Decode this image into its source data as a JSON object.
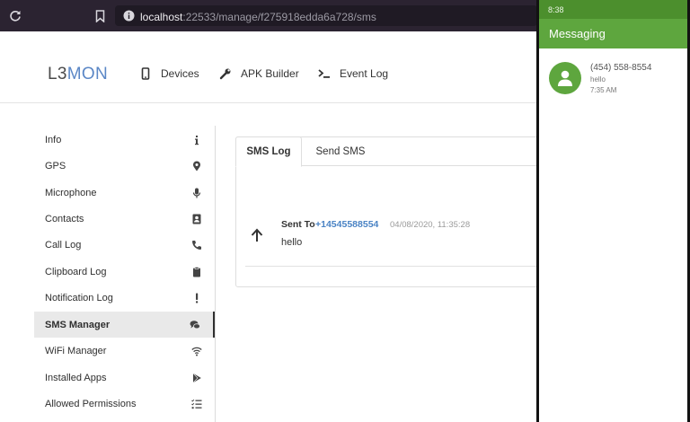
{
  "browser": {
    "url_host": "localhost",
    "url_rest": ":22533/manage/f275918edda6a728/sms"
  },
  "header": {
    "logo_part1": "L3",
    "logo_part2": "MON",
    "nav": [
      {
        "label": "Devices",
        "icon": "mobile-icon"
      },
      {
        "label": "APK Builder",
        "icon": "wrench-icon"
      },
      {
        "label": "Event Log",
        "icon": "terminal-icon"
      }
    ]
  },
  "sidebar": {
    "items": [
      {
        "label": "Info",
        "icon": "info-icon"
      },
      {
        "label": "GPS",
        "icon": "map-marker-icon"
      },
      {
        "label": "Microphone",
        "icon": "microphone-icon"
      },
      {
        "label": "Contacts",
        "icon": "address-book-icon"
      },
      {
        "label": "Call Log",
        "icon": "phone-icon"
      },
      {
        "label": "Clipboard Log",
        "icon": "clipboard-icon"
      },
      {
        "label": "Notification Log",
        "icon": "exclamation-icon"
      },
      {
        "label": "SMS Manager",
        "icon": "chat-icon",
        "active": true
      },
      {
        "label": "WiFi Manager",
        "icon": "wifi-icon"
      },
      {
        "label": "Installed Apps",
        "icon": "play-store-icon"
      },
      {
        "label": "Allowed Permissions",
        "icon": "list-icon"
      }
    ]
  },
  "tabs": {
    "sms_log": "SMS Log",
    "send_sms": "Send SMS"
  },
  "message": {
    "direction_label": "Sent To",
    "number": "+14545588554",
    "date": "04/08/2020, 11:35:28",
    "body": "hello"
  },
  "phone": {
    "status_time": "8:38",
    "app_title": "Messaging",
    "conversation": {
      "number": "(454) 558-8554",
      "snippet": "hello",
      "time": "7:35 AM"
    }
  },
  "colors": {
    "accent_blue": "#4a83c4",
    "android_green": "#5ea63e",
    "android_status_green": "#4c8f2d",
    "browser_bar": "#2b2331"
  }
}
